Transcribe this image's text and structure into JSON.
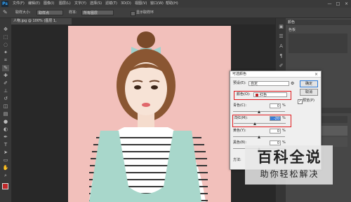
{
  "app": {
    "logo": "Ps"
  },
  "menubar": {
    "items": [
      "文件(F)",
      "编辑(E)",
      "图像(I)",
      "图层(L)",
      "文字(Y)",
      "选择(S)",
      "滤镜(T)",
      "3D(D)",
      "视图(V)",
      "窗口(W)",
      "帮助(H)"
    ]
  },
  "window_controls": {
    "minimize": "—",
    "maximize": "□",
    "close": "×"
  },
  "options": {
    "brush_size_label": "取样大小:",
    "brush_size_value": "取样点",
    "sample_label": "样本:",
    "sample_value": "所有图层",
    "show_ring_label": "显示取样环"
  },
  "document": {
    "tab_label": "人物.jpg @ 100% (图层 1, RGB/8#) *"
  },
  "panels": {
    "top_tab": "颜色",
    "top_sub": "色板",
    "layers_tab": "图层",
    "swatches_label": "样式"
  },
  "dialog": {
    "title": "可选颜色",
    "preset_label": "预设(E):",
    "preset_value": "自定",
    "colors_label": "颜色(O):",
    "colors_value": "红色",
    "cyan_label": "青色(C):",
    "cyan_value": "0",
    "magenta_label": "洋红(M):",
    "magenta_value": "-20",
    "yellow_label": "黄色(Y):",
    "yellow_value": "0",
    "black_label": "黑色(B):",
    "black_value": "0",
    "percent": "%",
    "ok_label": "确定",
    "cancel_label": "取消",
    "preview_label": "预览(P)",
    "method_label": "方法:"
  },
  "watermark": {
    "title": "百科全说",
    "subtitle": "助你轻松解决"
  },
  "colors": {
    "accent_red": "#e0191d",
    "swatch_red": "#c0282b"
  }
}
